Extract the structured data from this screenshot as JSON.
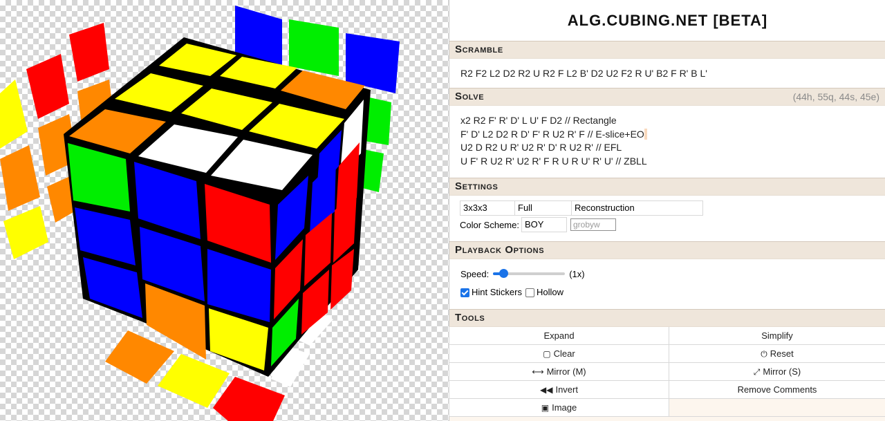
{
  "app": {
    "title": "ALG.CUBING.NET [BETA]"
  },
  "scramble": {
    "heading": "Scramble",
    "text": "R2 F2 L2 D2 R2 U R2 F L2 B' D2 U2 F2 R U' B2 F R' B L'"
  },
  "solve": {
    "heading": "Solve",
    "stats": "(44h, 55q, 44s, 45e)",
    "lines": [
      "x2 R2 F' R' D' L U' F D2 // Rectangle",
      "F' D' L2 D2 R D' F' R U2 R' F // E-slice+EO",
      "U2 D R2 U R' U2 R' D' R U2 R' // EFL",
      "U F' R U2 R' U2 R' F R U R U' R' U' // ZBLL"
    ]
  },
  "settings": {
    "heading": "Settings",
    "puzzle": "3x3x3",
    "stage": "Full",
    "type": "Reconstruction",
    "color_scheme_label": "Color Scheme:",
    "color_scheme": "BOY",
    "color_scheme_placeholder": "grobyw"
  },
  "playback": {
    "heading": "Playback Options",
    "speed_label": "Speed:",
    "speed_value": "(1x)",
    "speed_fraction": 0.1,
    "hint_stickers_label": "Hint Stickers",
    "hint_stickers_checked": true,
    "hollow_label": "Hollow",
    "hollow_checked": false
  },
  "tools": {
    "heading": "Tools",
    "expand": "Expand",
    "simplify": "Simplify",
    "clear": "Clear",
    "reset": "Reset",
    "mirror_m": "Mirror (M)",
    "mirror_s": "Mirror (S)",
    "invert": "Invert",
    "remove_comments": "Remove Comments",
    "image": "Image"
  },
  "colors": {
    "accent": "#1a73e8",
    "section_header_bg": "#efe6db",
    "cube_white": "#ffffff",
    "cube_yellow": "#ffff00",
    "cube_red": "#ff0000",
    "cube_orange": "#ff8800",
    "cube_blue": "#0000ff",
    "cube_green": "#00ee00"
  }
}
